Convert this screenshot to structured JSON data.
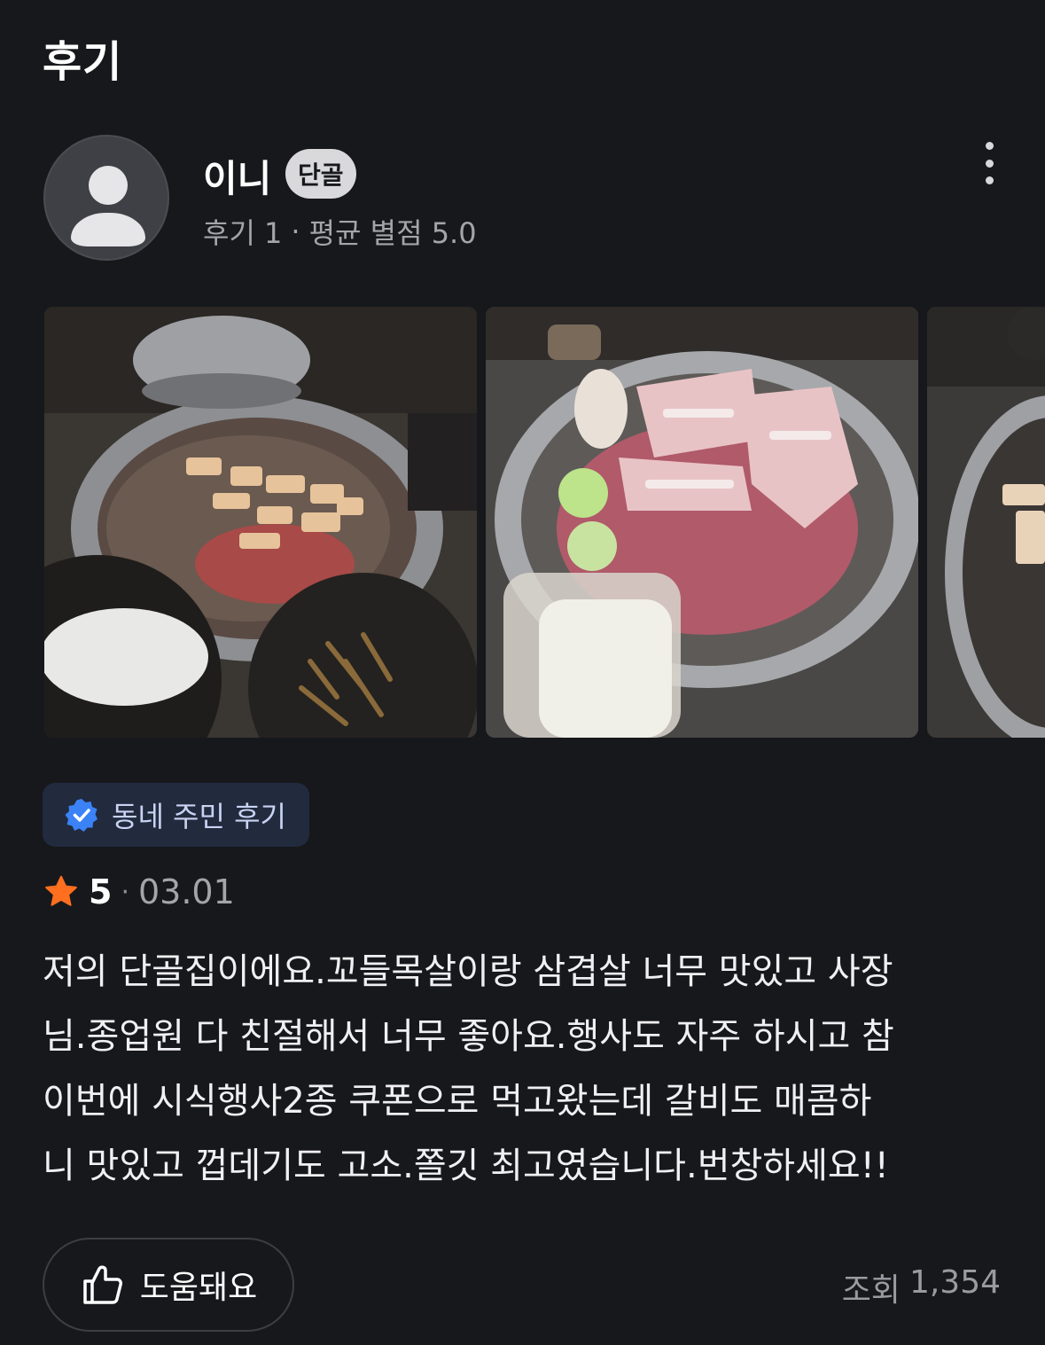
{
  "section_title": "후기",
  "author": {
    "name": "이니",
    "badge": "단골",
    "review_count": "후기 1",
    "separator": "·",
    "average_rating": "평균 별점 5.0"
  },
  "photos": [
    {
      "subject": "grill-photo-1"
    },
    {
      "subject": "grill-photo-2"
    },
    {
      "subject": "grill-photo-3"
    }
  ],
  "neighbor_badge": {
    "label": "동네 주민 후기",
    "icon": "verified-check-icon",
    "color": "#3b82f6"
  },
  "rating": {
    "score": "5",
    "separator": "·",
    "date": "03.01",
    "star_color": "#ff6f1f",
    "stars_value": 5
  },
  "review_text": "저의 단골집이에요.꼬들목살이랑 삼겹살 너무 맛있고 사장\n님.종업원 다 친절해서 너무 좋아요.행사도 자주 하시고 참\n이번에 시식행사2종 쿠폰으로 먹고왔는데 갈비도 매콤하\n니 맛있고 껍데기도 고소.쫄깃 최고였습니다.번창하세요!!",
  "footer": {
    "helpful_label": "도움돼요",
    "views_label": "조회",
    "views_count": "1,354"
  }
}
